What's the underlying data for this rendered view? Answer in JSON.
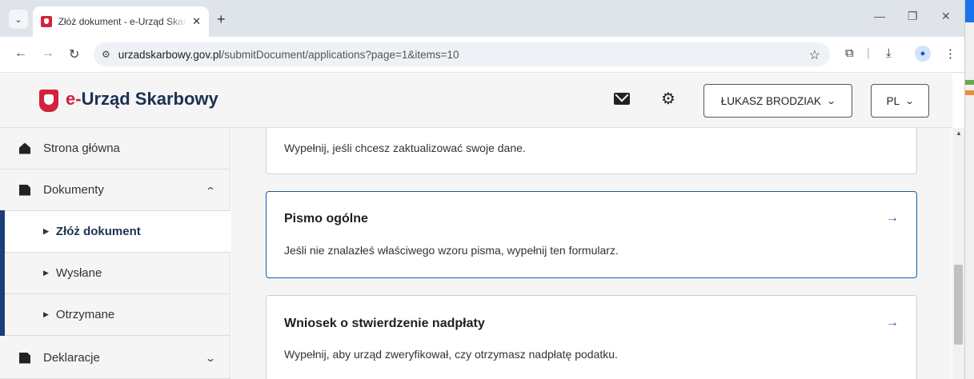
{
  "browser": {
    "tab": {
      "title": "Złóż dokument - e-Urząd Skarbowy",
      "close": "✕"
    },
    "new_tab": "+",
    "window_controls": {
      "minimize": "—",
      "restore": "❐",
      "close": "✕"
    },
    "url_domain": "urzadskarbowy.gov.pl",
    "url_path": "/submitDocument/applications?page=1&items=10",
    "icons": [
      "back-icon",
      "forward-icon",
      "reload-icon",
      "site-info-icon",
      "star-icon",
      "extensions-icon",
      "download-icon",
      "profile-icon",
      "menu-icon"
    ]
  },
  "header": {
    "brand_prefix": "e-",
    "brand_name": "Urząd Skarbowy",
    "user_name": "ŁUKASZ BRODZIAK",
    "language": "PL"
  },
  "sidebar": {
    "items": [
      {
        "label": "Strona główna"
      },
      {
        "label": "Dokumenty"
      },
      {
        "label": "Złóż dokument"
      },
      {
        "label": "Wysłane"
      },
      {
        "label": "Otrzymane"
      },
      {
        "label": "Deklaracje"
      }
    ]
  },
  "main": {
    "cards": [
      {
        "title": "",
        "description": "Wypełnij, jeśli chcesz zaktualizować swoje dane."
      },
      {
        "title": "Pismo ogólne",
        "description": "Jeśli nie znalazłeś właściwego wzoru pisma, wypełnij ten formularz."
      },
      {
        "title": "Wniosek o stwierdzenie nadpłaty",
        "description": "Wypełnij, aby urząd zweryfikował, czy otrzymasz nadpłatę podatku."
      }
    ]
  },
  "colors": {
    "brand_navy": "#1b3152",
    "brand_red": "#d4213d",
    "link_blue": "#1b5d9c"
  }
}
